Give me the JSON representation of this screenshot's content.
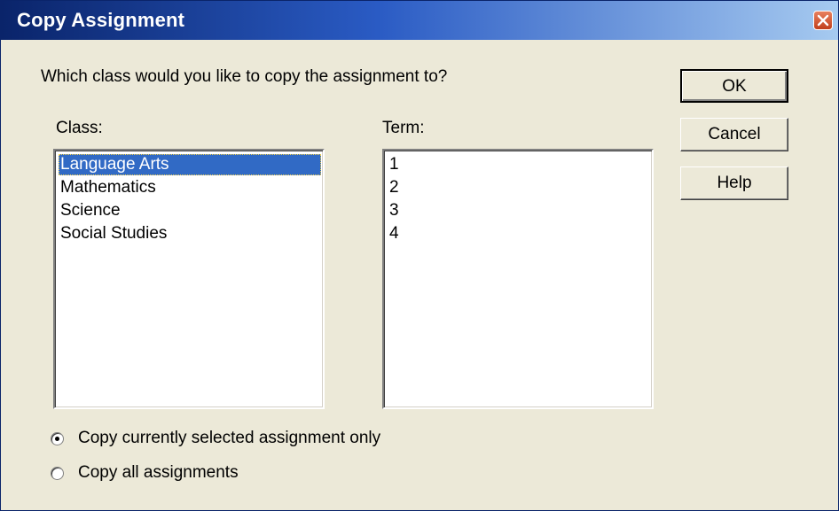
{
  "window": {
    "title": "Copy Assignment"
  },
  "prompt": "Which class would you like to copy the assignment to?",
  "class_list": {
    "label": "Class:",
    "items": [
      "Language Arts",
      "Mathematics",
      "Science",
      "Social Studies"
    ],
    "selected": "Language Arts"
  },
  "term_list": {
    "label": "Term:",
    "items": [
      "1",
      "2",
      "3",
      "4"
    ]
  },
  "buttons": {
    "ok": "OK",
    "cancel": "Cancel",
    "help": "Help"
  },
  "options": {
    "current_only": "Copy currently selected assignment only",
    "all": "Copy all assignments",
    "selected": "current_only"
  },
  "colors": {
    "selection": "#316ac5",
    "title_bar": "#0a246a",
    "dialog_bg": "#ece9d8"
  }
}
